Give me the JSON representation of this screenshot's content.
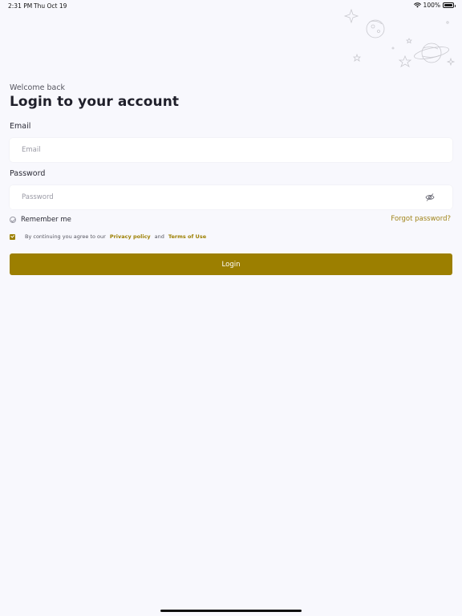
{
  "status_bar": {
    "time": "2:31 PM",
    "date": "Thu Oct 19",
    "battery": "100%",
    "icons": [
      "wifi-icon",
      "battery-icon"
    ]
  },
  "header": {
    "welcome": "Welcome back",
    "title": "Login to your account"
  },
  "form": {
    "email_label": "Email",
    "email_placeholder": "Email",
    "email_value": "",
    "password_label": "Password",
    "password_placeholder": "Password",
    "password_value": "",
    "password_toggle_icon": "eye-slash-icon",
    "remember_label": "Remember me",
    "forgot_label": "Forgot password?",
    "agree_prefix": "By continuing you agree to our",
    "privacy_label": "Privacy policy",
    "agree_and": "and",
    "terms_label": "Terms of Use",
    "agree_checked": true,
    "login_label": "Login"
  },
  "decor": {
    "icons": [
      "planet-icon",
      "moon-icon",
      "star-icon",
      "sparkle-icon"
    ]
  },
  "colors": {
    "accent": "#9c7f00",
    "background": "#f8f8fd",
    "input_background": "#ffffff"
  }
}
